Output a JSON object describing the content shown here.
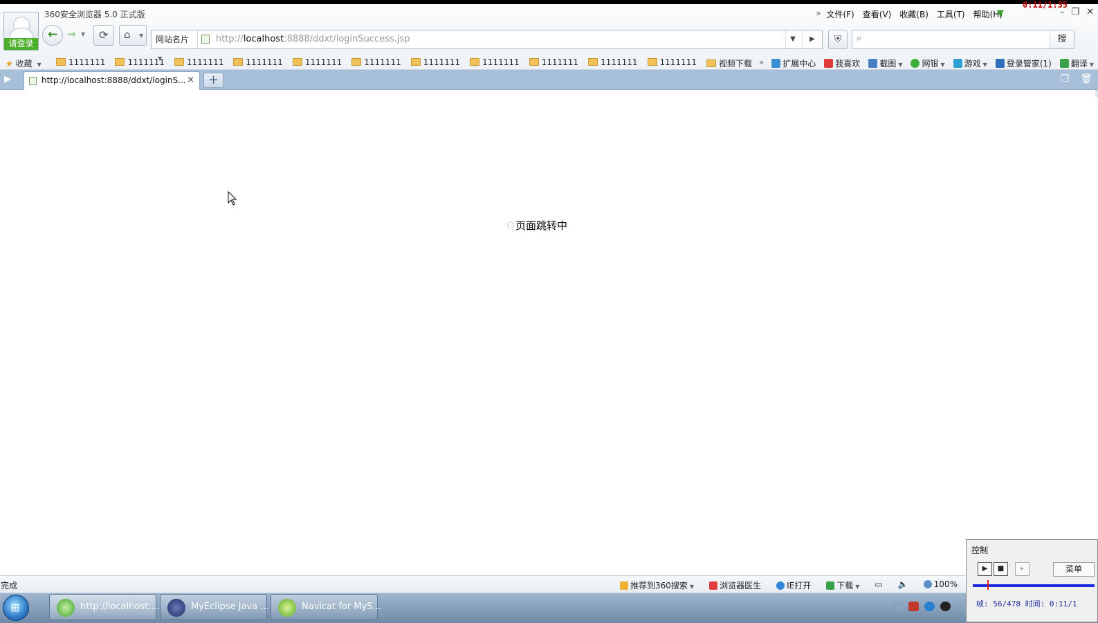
{
  "window": {
    "title": "360安全浏览器 5.0 正式版",
    "timer_overlay": "0:11/1:35",
    "login_button": "请登录"
  },
  "menu": {
    "more": "»",
    "items": [
      "文件(F)",
      "查看(V)",
      "收藏(B)",
      "工具(T)",
      "帮助(H)"
    ]
  },
  "navigation": {
    "sites_label": "网站名片",
    "url_host": "http://localhost",
    "url_host_bold": "localhost",
    "url_prefix": "http://",
    "url_rest": ":8888/ddxt/loginSuccess.jsp",
    "search_placeholder": "",
    "search_button": "搜"
  },
  "bookmarks": {
    "favorites_label": "收藏",
    "folders": [
      "1111111",
      "1111111",
      "1111111",
      "1111111",
      "1111111",
      "1111111",
      "1111111",
      "1111111",
      "1111111",
      "1111111",
      "1111111",
      "视频下载"
    ],
    "more": "»",
    "right_items": [
      "扩展中心",
      "我喜欢",
      "截图",
      "网银",
      "游戏",
      "登录管家(1)",
      "翻译"
    ]
  },
  "tabs": {
    "active_label": "http://localhost:8888/ddxt/loginS...",
    "close": "×",
    "new_tab": "+"
  },
  "content": {
    "loading_text": "页面跳转中"
  },
  "status": {
    "left": "完成",
    "right_items": [
      "推荐到360搜索",
      "浏览器医生",
      "IE打开",
      "下载",
      "100%"
    ]
  },
  "taskbar": {
    "items": [
      "http://localhost:...",
      "MyEclipse Java ...",
      "Navicat for MyS..."
    ]
  },
  "recorder": {
    "title": "控制",
    "menu_button": "菜单",
    "info": "帧: 56/478 时间: 0:11/1",
    "progress": 0.117
  },
  "colors": {
    "tab_bar": "#a7bfd8",
    "login_green": "#4caf2a",
    "timer_red": "#c00000"
  }
}
